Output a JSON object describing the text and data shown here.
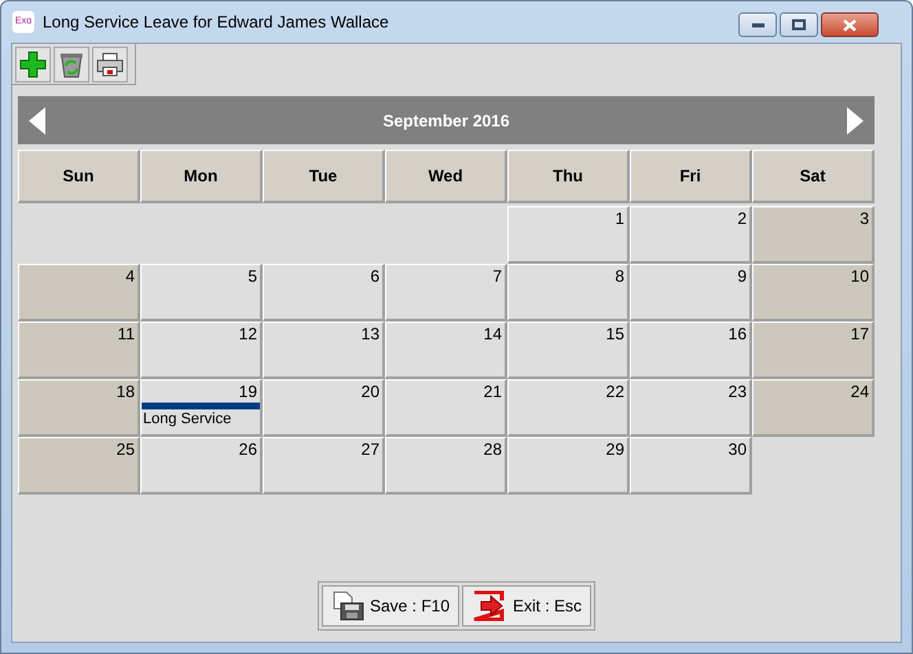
{
  "window": {
    "title": "Long Service Leave for Edward James Wallace",
    "app_badge": "Exo"
  },
  "calendar": {
    "month": "September 2016",
    "weekdays": [
      "Sun",
      "Mon",
      "Tue",
      "Wed",
      "Thu",
      "Fri",
      "Sat"
    ],
    "days": [
      {
        "kind": "empty"
      },
      {
        "kind": "empty"
      },
      {
        "kind": "empty"
      },
      {
        "kind": "empty"
      },
      {
        "kind": "day",
        "day": "1",
        "weekend": false
      },
      {
        "kind": "day",
        "day": "2",
        "weekend": false
      },
      {
        "kind": "day",
        "day": "3",
        "weekend": true
      },
      {
        "kind": "day",
        "day": "4",
        "weekend": true
      },
      {
        "kind": "day",
        "day": "5",
        "weekend": false
      },
      {
        "kind": "day",
        "day": "6",
        "weekend": false
      },
      {
        "kind": "day",
        "day": "7",
        "weekend": false
      },
      {
        "kind": "day",
        "day": "8",
        "weekend": false
      },
      {
        "kind": "day",
        "day": "9",
        "weekend": false
      },
      {
        "kind": "day",
        "day": "10",
        "weekend": true
      },
      {
        "kind": "day",
        "day": "11",
        "weekend": true
      },
      {
        "kind": "day",
        "day": "12",
        "weekend": false
      },
      {
        "kind": "day",
        "day": "13",
        "weekend": false
      },
      {
        "kind": "day",
        "day": "14",
        "weekend": false
      },
      {
        "kind": "day",
        "day": "15",
        "weekend": false
      },
      {
        "kind": "day",
        "day": "16",
        "weekend": false
      },
      {
        "kind": "day",
        "day": "17",
        "weekend": true
      },
      {
        "kind": "day",
        "day": "18",
        "weekend": true
      },
      {
        "kind": "day",
        "day": "19",
        "weekend": false,
        "events": [
          {
            "label": "Long Service",
            "color": "#003f7f"
          }
        ]
      },
      {
        "kind": "day",
        "day": "20",
        "weekend": false
      },
      {
        "kind": "day",
        "day": "21",
        "weekend": false
      },
      {
        "kind": "day",
        "day": "22",
        "weekend": false
      },
      {
        "kind": "day",
        "day": "23",
        "weekend": false
      },
      {
        "kind": "day",
        "day": "24",
        "weekend": true
      },
      {
        "kind": "day",
        "day": "25",
        "weekend": true
      },
      {
        "kind": "day",
        "day": "26",
        "weekend": false
      },
      {
        "kind": "day",
        "day": "27",
        "weekend": false
      },
      {
        "kind": "day",
        "day": "28",
        "weekend": false
      },
      {
        "kind": "day",
        "day": "29",
        "weekend": false
      },
      {
        "kind": "day",
        "day": "30",
        "weekend": false
      }
    ]
  },
  "buttons": [
    {
      "kind": "save",
      "label": "Save : F10"
    },
    {
      "kind": "exit",
      "label": "Exit : Esc"
    }
  ]
}
